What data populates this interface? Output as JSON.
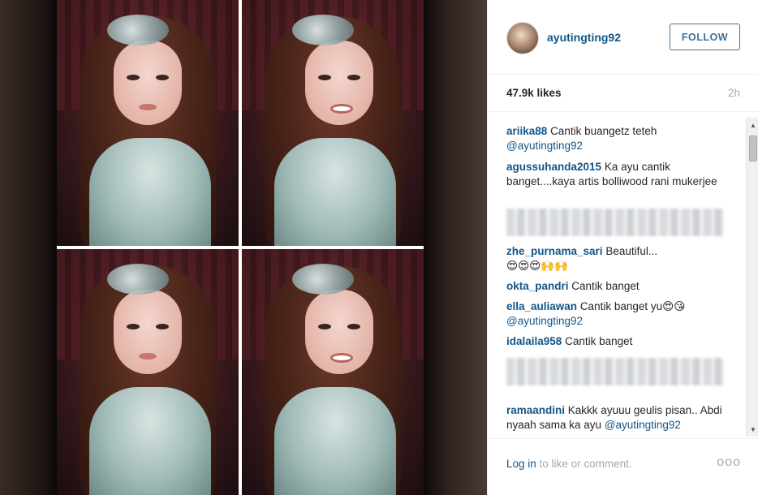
{
  "post": {
    "username": "ayutingting92",
    "follow_label": "FOLLOW",
    "likes": "47.9k likes",
    "time": "2h",
    "image_alt": "Four-panel collage photo"
  },
  "comments": [
    {
      "user": "ariika88",
      "text": "Cantik buangetz teteh",
      "mention": "@ayutingting92"
    },
    {
      "user": "agussuhanda2015",
      "text": "Ka ayu cantik banget....kaya artis bolliwood rani mukerjee",
      "mention": ""
    },
    {
      "user": "zhe_purnama_sari",
      "text": "Beautiful...",
      "emoji": "😍😍😍🙌🙌",
      "mention": ""
    },
    {
      "user": "okta_pandri",
      "text": "Cantik banget",
      "mention": ""
    },
    {
      "user": "ella_auliawan",
      "text": "Cantik banget yu😍😘",
      "mention": "@ayutingting92"
    },
    {
      "user": "idalaila958",
      "text": "Cantik banget",
      "mention": ""
    },
    {
      "user": "ramaandini",
      "text": "Kakkk ayuuu geulis pisan.. Abdi nyaah sama ka ayu",
      "mention": "@ayutingting92"
    }
  ],
  "footer": {
    "login_link": "Log in",
    "login_rest": " to like or comment.",
    "more": "ooo"
  },
  "colors": {
    "link": "#125688",
    "follow_border": "#3f729b",
    "muted": "#a5a7aa"
  },
  "icons": {
    "more": "ellipsis-icon",
    "scroll_up": "arrow-up-icon",
    "scroll_down": "arrow-down-icon"
  }
}
